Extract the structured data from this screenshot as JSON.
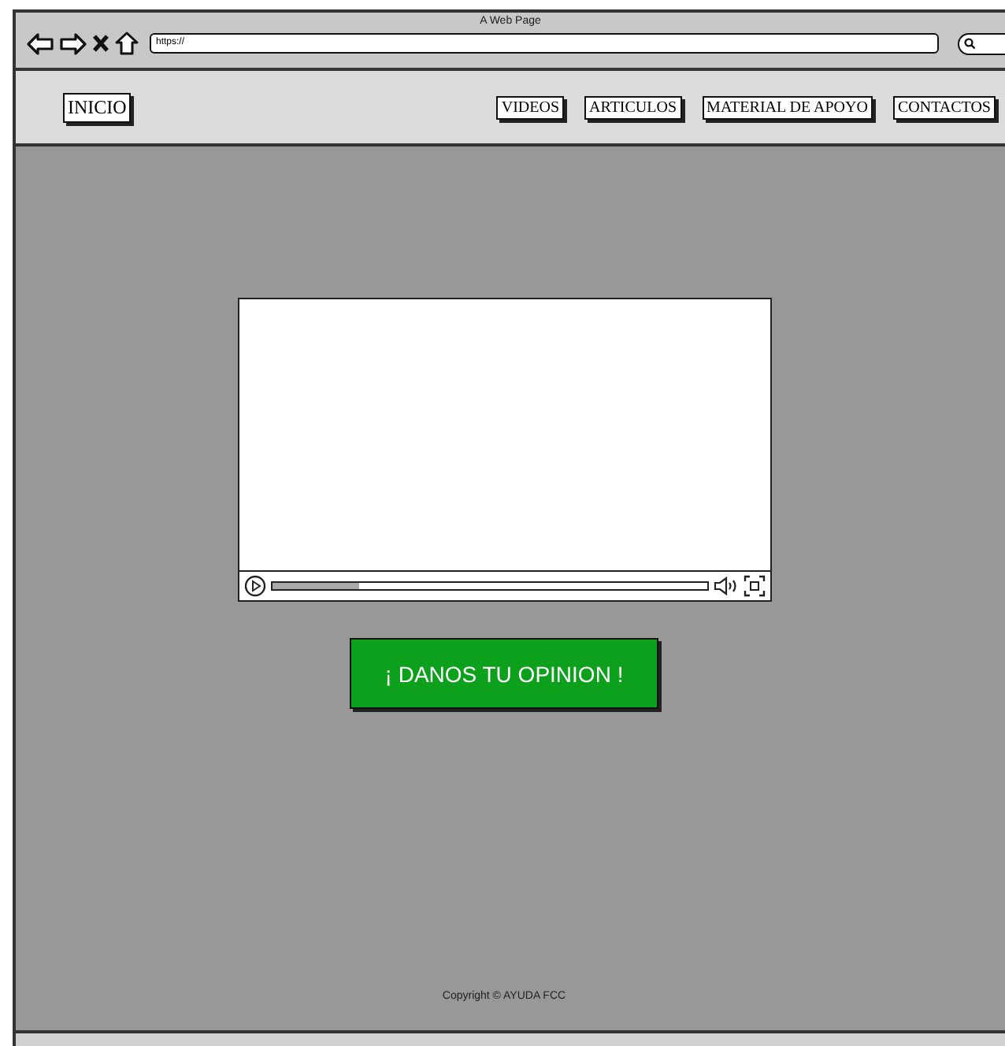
{
  "window": {
    "title": "A Web Page"
  },
  "address_bar": {
    "value": "https://"
  },
  "nav": {
    "home": "INICIO",
    "links": [
      "VIDEOS",
      "ARTICULOS",
      "MATERIAL DE APOYO",
      "CONTACTOS"
    ]
  },
  "video": {
    "level": 0.2
  },
  "cta_button": "¡ DANOS TU OPINION !",
  "footer": "Copyright © AYUDA FCC"
}
